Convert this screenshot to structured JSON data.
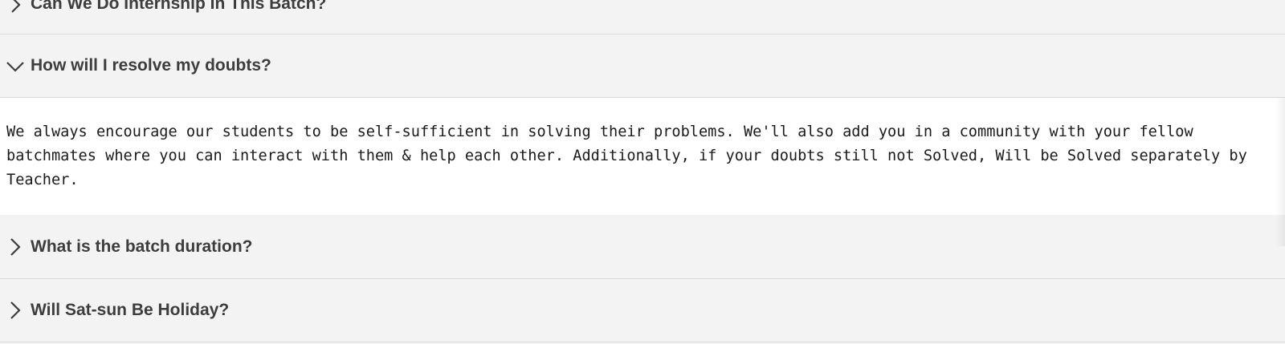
{
  "faq": {
    "items": [
      {
        "question": "Can We Do Internship In This Batch?",
        "state": "collapsed",
        "icon": "chevron-right-icon"
      },
      {
        "question": "How will I resolve my doubts?",
        "state": "expanded",
        "icon": "chevron-down-icon",
        "answer": "We always encourage our students to be self-sufficient in solving their problems. We'll also add you in a community with your fellow batchmates where you can interact with them & help each other. Additionally, if your doubts still not Solved, Will be Solved separately by Teacher."
      },
      {
        "question": "What is the batch duration?",
        "state": "collapsed",
        "icon": "chevron-right-icon"
      },
      {
        "question": "Will Sat-sun Be Holiday?",
        "state": "collapsed",
        "icon": "chevron-right-icon"
      }
    ]
  },
  "colors": {
    "header_bg": "#f3f3f3",
    "answer_bg": "#ffffff",
    "question_text": "#3d3d3d",
    "answer_text": "#1a1a1a",
    "divider": "#d9d9d9"
  }
}
